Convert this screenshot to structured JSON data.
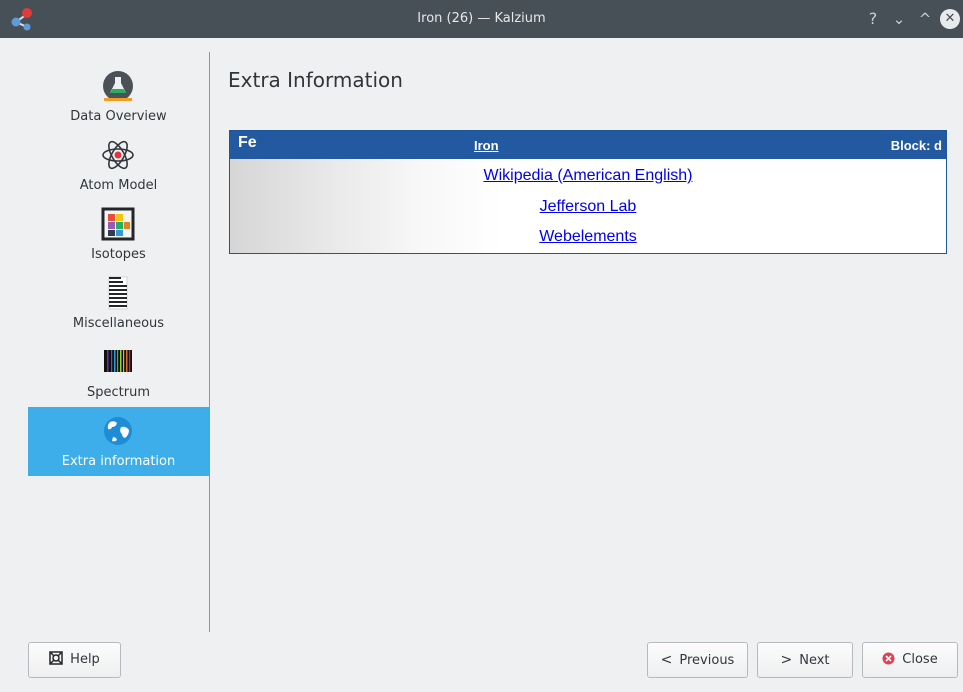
{
  "window": {
    "title": "Iron (26) — Kalzium",
    "help_glyph": "?",
    "minimize_glyph": "⌄",
    "maximize_glyph": "^",
    "close_glyph": "✕"
  },
  "sidebar": {
    "items": [
      {
        "label": "Data Overview",
        "icon": "flask-icon",
        "active": false
      },
      {
        "label": "Atom Model",
        "icon": "atom-icon",
        "active": false
      },
      {
        "label": "Isotopes",
        "icon": "isotopes-icon",
        "active": false
      },
      {
        "label": "Miscellaneous",
        "icon": "miscellaneous-icon",
        "active": false
      },
      {
        "label": "Spectrum",
        "icon": "spectrum-icon",
        "active": false
      },
      {
        "label": "Extra information",
        "icon": "globe-icon",
        "active": true
      }
    ]
  },
  "main": {
    "title": "Extra Information",
    "element": {
      "symbol": "Fe",
      "name": "Iron",
      "block": "Block: d"
    },
    "links": [
      "Wikipedia (American English)",
      "Jefferson Lab",
      "Webelements"
    ]
  },
  "footer": {
    "help": "Help",
    "previous": "Previous",
    "next": "Next",
    "close": "Close",
    "previous_glyph": "<",
    "next_glyph": ">"
  },
  "colors": {
    "accent": "#3daee9",
    "header_blue": "#2359a1",
    "titlebar": "#475057",
    "close_red": "#da4453"
  }
}
